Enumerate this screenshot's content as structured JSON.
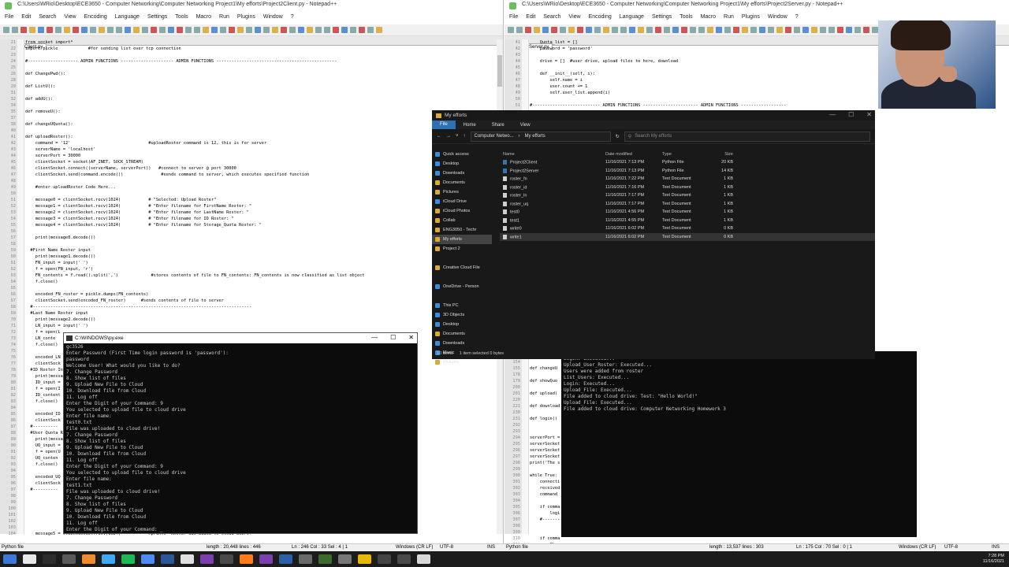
{
  "client_editor": {
    "title": "C:\\Users\\WRio\\Desktop\\ECE3650 - Computer Networking\\Computer Networking Project1\\My efforts\\Project2Client.py - Notepad++",
    "menu": [
      "File",
      "Edit",
      "Search",
      "View",
      "Encoding",
      "Language",
      "Settings",
      "Tools",
      "Macro",
      "Run",
      "Plugins",
      "Window",
      "?"
    ],
    "tab": "Project2Client.py",
    "lines": [
      {
        "n": "21",
        "t": "from socket import*",
        "c": ""
      },
      {
        "n": "22",
        "t": "import pickle            #for sending list over tcp connection",
        "c": ""
      },
      {
        "n": "23",
        "t": "",
        "c": ""
      },
      {
        "n": "24",
        "t": "#-------------------- ADMIN FUNCTIONS --------------------- ADMIN FUNCTIONS ------------------------------------------------",
        "c": "cm"
      },
      {
        "n": "25",
        "t": "",
        "c": ""
      },
      {
        "n": "26",
        "t": "def ChangePwd():",
        "c": "kw"
      },
      {
        "n": "28",
        "t": "",
        "c": ""
      },
      {
        "n": "29",
        "t": "def ListU():",
        "c": "kw"
      },
      {
        "n": "31",
        "t": "",
        "c": ""
      },
      {
        "n": "32",
        "t": "def addU():",
        "c": "kw"
      },
      {
        "n": "34",
        "t": "",
        "c": ""
      },
      {
        "n": "35",
        "t": "def removeU():",
        "c": "kw"
      },
      {
        "n": "37",
        "t": "",
        "c": ""
      },
      {
        "n": "38",
        "t": "def changeUQuota():",
        "c": "kw"
      },
      {
        "n": "40",
        "t": "",
        "c": ""
      },
      {
        "n": "41",
        "t": "def uploadRoster():",
        "c": "kw"
      },
      {
        "n": "42",
        "t": "    command = '12'                               #uploadRoster command is 12, this is for server",
        "c": ""
      },
      {
        "n": "43",
        "t": "    serverName = 'localhost'",
        "c": ""
      },
      {
        "n": "44",
        "t": "    serverPort = 30000",
        "c": ""
      },
      {
        "n": "45",
        "t": "    clientSocket = socket(AF_INET, SOCK_STREAM)",
        "c": ""
      },
      {
        "n": "46",
        "t": "    clientSocket.connect((serverName, serverPort))   #connect to server @ port 30000",
        "c": ""
      },
      {
        "n": "47",
        "t": "    clientSocket.send(command.encode())               #sends command to server, which executes specified function",
        "c": ""
      },
      {
        "n": "48",
        "t": "",
        "c": ""
      },
      {
        "n": "49",
        "t": "    #enter uploadRoster Code Here...",
        "c": "cm"
      },
      {
        "n": "50",
        "t": "",
        "c": ""
      },
      {
        "n": "51",
        "t": "    message0 = clientSocket.recv(1024)           # \"Selected: Upload Roster\"",
        "c": ""
      },
      {
        "n": "52",
        "t": "    message1 = clientSocket.recv(1024)           # \"Enter filename for FirstName Roster: \"",
        "c": ""
      },
      {
        "n": "53",
        "t": "    message2 = clientSocket.recv(1024)           # \"Enter filename for LastName Roster: \"",
        "c": ""
      },
      {
        "n": "54",
        "t": "    message3 = clientSocket.recv(1024)           # \"Enter filename for ID Roster: \"",
        "c": ""
      },
      {
        "n": "55",
        "t": "    message4 = clientSocket.recv(1024)           # \"Enter filename for Storage_Quota Roster: \"",
        "c": ""
      },
      {
        "n": "56",
        "t": "",
        "c": ""
      },
      {
        "n": "57",
        "t": "    print(message0.decode())",
        "c": ""
      },
      {
        "n": "58",
        "t": "",
        "c": ""
      },
      {
        "n": "59",
        "t": "  #First Name Roster input",
        "c": "cm"
      },
      {
        "n": "60",
        "t": "    print(message1.decode())",
        "c": ""
      },
      {
        "n": "61",
        "t": "    FN_input = input(' ')",
        "c": ""
      },
      {
        "n": "62",
        "t": "    f = open(FN_input, 'r')",
        "c": ""
      },
      {
        "n": "63",
        "t": "    FN_contents = f.read().split(',')             #stores contents of file to FN_contents: FN_contents is now classified as list object",
        "c": ""
      },
      {
        "n": "64",
        "t": "    f.close()",
        "c": ""
      },
      {
        "n": "65",
        "t": "",
        "c": ""
      },
      {
        "n": "66",
        "t": "    encoded_FN_roster = pickle.dumps(FN_contents)",
        "c": ""
      },
      {
        "n": "67",
        "t": "    clientSocket.send(encoded_FN_roster)      #sends contents of file to server",
        "c": ""
      },
      {
        "n": "68",
        "t": "  #---------------------------------------------------------------------------------------",
        "c": "cm"
      },
      {
        "n": "69",
        "t": "  #Last Name Roster input",
        "c": "cm"
      },
      {
        "n": "70",
        "t": "    print(message2.decode())",
        "c": ""
      },
      {
        "n": "71",
        "t": "    LN_input = input(' ')",
        "c": ""
      },
      {
        "n": "72",
        "t": "    f = open(L",
        "c": ""
      },
      {
        "n": "73",
        "t": "    LN_conte",
        "c": ""
      },
      {
        "n": "74",
        "t": "    f.close()",
        "c": ""
      },
      {
        "n": "75",
        "t": "",
        "c": ""
      },
      {
        "n": "76",
        "t": "    encoded_LN",
        "c": ""
      },
      {
        "n": "77",
        "t": "    clientSock",
        "c": ""
      },
      {
        "n": "78",
        "t": "  #ID Roster In",
        "c": "cm"
      },
      {
        "n": "79",
        "t": "    print(messa",
        "c": ""
      },
      {
        "n": "80",
        "t": "    ID_input =",
        "c": ""
      },
      {
        "n": "81",
        "t": "    f = open(I",
        "c": ""
      },
      {
        "n": "82",
        "t": "    ID_content",
        "c": ""
      },
      {
        "n": "83",
        "t": "    f.close()",
        "c": ""
      },
      {
        "n": "84",
        "t": "",
        "c": ""
      },
      {
        "n": "85",
        "t": "    encoded_ID",
        "c": ""
      },
      {
        "n": "86",
        "t": "    clientSock",
        "c": ""
      },
      {
        "n": "87",
        "t": "  #----------",
        "c": "cm"
      },
      {
        "n": "88",
        "t": "  #User Quota R",
        "c": "cm"
      },
      {
        "n": "89",
        "t": "    print(messa",
        "c": ""
      },
      {
        "n": "90",
        "t": "    UQ_input =",
        "c": ""
      },
      {
        "n": "91",
        "t": "    f = open(U",
        "c": ""
      },
      {
        "n": "92",
        "t": "    UQ_conten",
        "c": ""
      },
      {
        "n": "93",
        "t": "    f.close()",
        "c": ""
      },
      {
        "n": "94",
        "t": "",
        "c": ""
      },
      {
        "n": "95",
        "t": "    encoded_UQ",
        "c": ""
      },
      {
        "n": "96",
        "t": "    clientSock",
        "c": ""
      },
      {
        "n": "97",
        "t": "  #----------",
        "c": "cm"
      },
      {
        "n": "98",
        "t": "",
        "c": ""
      },
      {
        "n": "99",
        "t": "",
        "c": ""
      },
      {
        "n": "100",
        "t": "",
        "c": ""
      },
      {
        "n": "101",
        "t": "",
        "c": ""
      },
      {
        "n": "102",
        "t": "",
        "c": ""
      },
      {
        "n": "103",
        "t": "",
        "c": ""
      },
      {
        "n": "104",
        "t": "    message5 = clientSocket.recv(1024)           #prints \"Roster was added to cloud users!\"",
        "c": ""
      }
    ],
    "status": {
      "type": "Python file",
      "length": "length : 20,448   lines : 446",
      "pos": "Ln : 246   Col : 33   Sel : 4 | 1",
      "eol": "Windows (CR LF)",
      "enc": "UTF-8",
      "ins": "INS"
    }
  },
  "server_editor": {
    "title": "C:\\Users\\WRio\\Desktop\\ECE3650 - Computer Networking\\Computer Networking Project1\\My efforts\\Project2Server.py - Notepad++",
    "menu": [
      "File",
      "Edit",
      "Search",
      "View",
      "Encoding",
      "Language",
      "Settings",
      "Tools",
      "Macro",
      "Run",
      "Plugins",
      "Window",
      "?"
    ],
    "tab": "Project2Server.py",
    "lines": [
      {
        "n": "41",
        "t": "    Quota_list = []",
        "c": ""
      },
      {
        "n": "42",
        "t": "    password = 'password'",
        "c": ""
      },
      {
        "n": "43",
        "t": "",
        "c": ""
      },
      {
        "n": "44",
        "t": "    drive = []  #user drive, upload files to here, download",
        "c": ""
      },
      {
        "n": "45",
        "t": "",
        "c": ""
      },
      {
        "n": "46",
        "t": "    def __init__(self, i):",
        "c": "kw"
      },
      {
        "n": "47",
        "t": "        self.name = i",
        "c": ""
      },
      {
        "n": "48",
        "t": "        user.count += 1",
        "c": ""
      },
      {
        "n": "49",
        "t": "        self.user_list.append(i)",
        "c": ""
      },
      {
        "n": "50",
        "t": "",
        "c": ""
      },
      {
        "n": "51",
        "t": "#--------------------------- ADMIN FUNCTIONS ---------------------- ADMIN FUNCTIONS ------------------",
        "c": "cm"
      }
    ],
    "lower_lines": [
      {
        "n": "154",
        "t": "",
        "c": ""
      },
      {
        "n": "155",
        "t": "def changeU",
        "c": "kw"
      },
      {
        "n": "178",
        "t": "",
        "c": ""
      },
      {
        "n": "179",
        "t": "def showQuo",
        "c": "kw"
      },
      {
        "n": "200",
        "t": "",
        "c": ""
      },
      {
        "n": "201",
        "t": "def upload(",
        "c": "kw"
      },
      {
        "n": "220",
        "t": "",
        "c": ""
      },
      {
        "n": "221",
        "t": "def download",
        "c": "kw"
      },
      {
        "n": "230",
        "t": "",
        "c": ""
      },
      {
        "n": "231",
        "t": "def login()",
        "c": "kw"
      },
      {
        "n": "292",
        "t": "",
        "c": ""
      },
      {
        "n": "293",
        "t": "",
        "c": ""
      },
      {
        "n": "294",
        "t": "serverPort =",
        "c": ""
      },
      {
        "n": "295",
        "t": "serverSocket",
        "c": ""
      },
      {
        "n": "296",
        "t": "serverSocket",
        "c": ""
      },
      {
        "n": "297",
        "t": "serverSocket",
        "c": ""
      },
      {
        "n": "298",
        "t": "print('The s",
        "c": ""
      },
      {
        "n": "299",
        "t": "",
        "c": ""
      },
      {
        "n": "300",
        "t": "while True:",
        "c": "kw"
      },
      {
        "n": "301",
        "t": "    connecti",
        "c": ""
      },
      {
        "n": "302",
        "t": "    received",
        "c": ""
      },
      {
        "n": "303",
        "t": "    command",
        "c": ""
      },
      {
        "n": "304",
        "t": "",
        "c": ""
      },
      {
        "n": "305",
        "t": "    if comma",
        "c": ""
      },
      {
        "n": "306",
        "t": "        logi",
        "c": ""
      },
      {
        "n": "307",
        "t": "    #-------",
        "c": "cm"
      },
      {
        "n": "308",
        "t": "",
        "c": ""
      },
      {
        "n": "309",
        "t": "",
        "c": ""
      },
      {
        "n": "310",
        "t": "    if comma",
        "c": ""
      },
      {
        "n": "311",
        "t": "        Chan",
        "c": ""
      }
    ],
    "status": {
      "type": "Python file",
      "length": "length : 13,537   lines : 303",
      "pos": "Ln : 175   Col : 70   Sel : 0 | 1",
      "eol": "Windows (CR LF)",
      "enc": "UTF-8",
      "ins": "INS"
    }
  },
  "client_console": {
    "title": "C:\\WINDOWS\\py.exe",
    "lines": [
      "gc3526",
      "Enter Password (First Time login password is 'password'):",
      "password",
      "Welcome User! What would you like to do?",
      "7. Change Password",
      "8. Show list of files",
      "9. Upload New File to Cloud",
      "10. Download file from Cloud",
      "11. Log off",
      "Enter the Digit of your Command: 9",
      "You selected to upload file to cloud drive",
      "Enter file name:",
      "test0.txt",
      "File was uploaded to cloud drive!",
      "7. Change Password",
      "8. Show list of files",
      "9. Upload New File to Cloud",
      "10. Download file from Cloud",
      "11. Log off",
      "Enter the Digit of your Command: 9",
      "You selected to upload file to cloud drive",
      "Enter file name:",
      "test1.txt",
      "File was uploaded to cloud drive!",
      "7. Change Password",
      "8. Show list of files",
      "9. Upload New File to Cloud",
      "10. Download file from Cloud",
      "11. Log off",
      "Enter the Digit of your Command: _"
    ]
  },
  "server_console": {
    "lines": [
      "Login: Executed...",
      "Upload_User_Roster: Executed...",
      "Users were added from roster",
      "List_Users: Executed...",
      "Login: Executed...",
      "Upload_File: Executed...",
      "File added to cloud drive: Test: \"Hello World!\"",
      "Upload_File: Executed...",
      "File added to cloud drive: Computer Networking Homework 3"
    ]
  },
  "explorer": {
    "title": "My efforts",
    "ribbon": [
      "File",
      "Home",
      "Share",
      "View"
    ],
    "breadcrumb": [
      "Computer Netwo...",
      "My efforts"
    ],
    "search_placeholder": "Search My efforts",
    "nav": [
      {
        "label": "Quick access",
        "cls": "blue"
      },
      {
        "label": "Desktop",
        "cls": "blue"
      },
      {
        "label": "Downloads",
        "cls": "blue"
      },
      {
        "label": "Documents",
        "cls": ""
      },
      {
        "label": "Pictures",
        "cls": ""
      },
      {
        "label": "iCloud Drive",
        "cls": "blue"
      },
      {
        "label": "iCloud Photos",
        "cls": ""
      },
      {
        "label": "Collab",
        "cls": ""
      },
      {
        "label": "ENG3050 - Techr",
        "cls": ""
      },
      {
        "label": "My efforts",
        "cls": "sel"
      },
      {
        "label": "Project 2",
        "cls": ""
      },
      {
        "label": "",
        "cls": "none"
      },
      {
        "label": "Creative Cloud File",
        "cls": ""
      },
      {
        "label": "",
        "cls": "none"
      },
      {
        "label": "OneDrive - Person",
        "cls": "blue"
      },
      {
        "label": "",
        "cls": "none"
      },
      {
        "label": "This PC",
        "cls": "blue"
      },
      {
        "label": "3D Objects",
        "cls": "blue"
      },
      {
        "label": "Desktop",
        "cls": "blue"
      },
      {
        "label": "Documents",
        "cls": ""
      },
      {
        "label": "Downloads",
        "cls": "blue"
      },
      {
        "label": "Music",
        "cls": "blue"
      },
      {
        "label": "Pictures",
        "cls": ""
      }
    ],
    "columns": [
      "Name",
      "Date modified",
      "Type",
      "Size"
    ],
    "files": [
      {
        "name": "Project2Client",
        "date": "11/16/2021 7:13 PM",
        "type": "Python File",
        "size": "20 KB",
        "py": true
      },
      {
        "name": "Project2Server",
        "date": "11/16/2021 7:13 PM",
        "type": "Python File",
        "size": "14 KB",
        "py": true
      },
      {
        "name": "roster_fn",
        "date": "11/16/2021 7:22 PM",
        "type": "Text Document",
        "size": "1 KB",
        "py": false
      },
      {
        "name": "roster_id",
        "date": "11/16/2021 7:16 PM",
        "type": "Text Document",
        "size": "1 KB",
        "py": false
      },
      {
        "name": "roster_ln",
        "date": "11/16/2021 7:17 PM",
        "type": "Text Document",
        "size": "1 KB",
        "py": false
      },
      {
        "name": "roster_uq",
        "date": "11/16/2021 7:17 PM",
        "type": "Text Document",
        "size": "1 KB",
        "py": false
      },
      {
        "name": "test0",
        "date": "11/16/2021 4:56 PM",
        "type": "Text Document",
        "size": "1 KB",
        "py": false
      },
      {
        "name": "test1",
        "date": "11/16/2021 4:55 PM",
        "type": "Text Document",
        "size": "1 KB",
        "py": false
      },
      {
        "name": "write0",
        "date": "11/16/2021 6:02 PM",
        "type": "Text Document",
        "size": "0 KB",
        "py": false
      },
      {
        "name": "write1",
        "date": "11/16/2021 6:02 PM",
        "type": "Text Document",
        "size": "0 KB",
        "py": false,
        "sel": true
      }
    ],
    "status_items": "10 items",
    "status_selected": "1 item selected  0 bytes"
  },
  "taskbar": {
    "time": "7:28 PM",
    "date": "11/16/2021",
    "colors": [
      "#3c78d8",
      "#e8e8e8",
      "#2d2d2d",
      "#5a5a5a",
      "#f28b2b",
      "#3fa9f5",
      "#1db954",
      "#4c8bf5",
      "#2b579a",
      "#e0e0e0",
      "#7b3fb0",
      "#4a4a4a",
      "#ff7a1a",
      "#7b3fb0",
      "#2b5fa8",
      "#6a6a6a",
      "#3d6a2d",
      "#777",
      "#e6b800",
      "#444",
      "#4a4a4a",
      "#d9d9d9"
    ]
  }
}
